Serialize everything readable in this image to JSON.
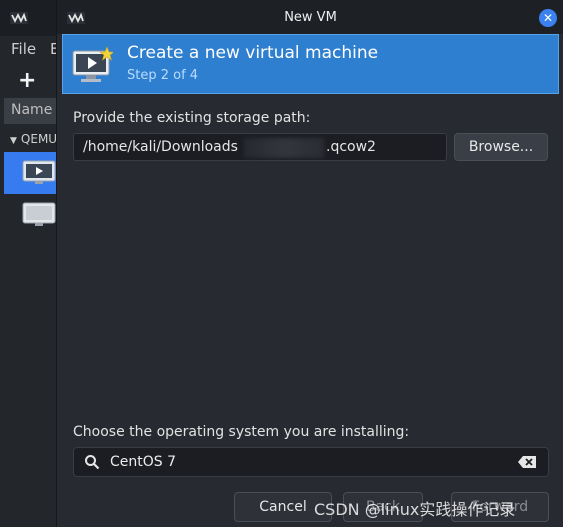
{
  "background_window": {
    "menu": [
      "File",
      "E"
    ],
    "add_label": "+",
    "column_header": "Name",
    "group_label": "QEMU"
  },
  "dialog": {
    "title": "New VM",
    "banner": {
      "title": "Create a new virtual machine",
      "subtitle": "Step 2 of 4"
    },
    "storage": {
      "label": "Provide the existing storage path:",
      "value_prefix": "/home/kali/Downloads",
      "value_suffix": ".qcow2",
      "browse_label": "Browse..."
    },
    "os": {
      "label": "Choose the operating system you are installing:",
      "value": "CentOS 7"
    },
    "buttons": {
      "cancel": "Cancel",
      "back": "Back",
      "forward": "Forward"
    }
  },
  "watermark": "CSDN @linux实践操作记录",
  "colors": {
    "accent": "#2f7fd0",
    "selection": "#367bf0",
    "close_button": "#3b82f0"
  },
  "icons": [
    "virt-manager-logo",
    "plus-icon",
    "monitor-icon",
    "new-vm-icon",
    "search-icon",
    "clear-icon",
    "close-icon"
  ]
}
